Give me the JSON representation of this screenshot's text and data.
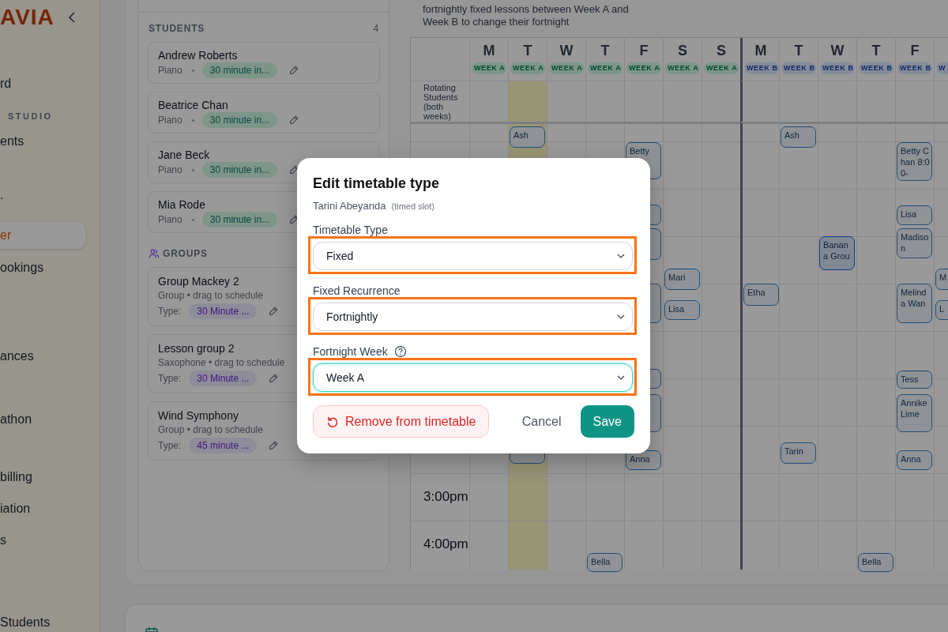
{
  "sidebar": {
    "logo": "AVIA",
    "items": [
      {
        "kind": "link",
        "label": "rd",
        "selected": false
      },
      {
        "kind": "section",
        "label": "STUDIO"
      },
      {
        "kind": "link",
        "label": "ents",
        "selected": false
      },
      {
        "kind": "link",
        "label": ".",
        "selected": false
      },
      {
        "kind": "link",
        "label": "er",
        "selected": true
      },
      {
        "kind": "link",
        "label": "ookings",
        "selected": false
      },
      {
        "kind": "link",
        "label": "ances",
        "selected": false
      },
      {
        "kind": "link",
        "label": "athon",
        "selected": false
      },
      {
        "kind": "link",
        "label": "billing",
        "selected": false
      },
      {
        "kind": "link",
        "label": "iation",
        "selected": false
      },
      {
        "kind": "link",
        "label": "s",
        "selected": false
      },
      {
        "kind": "link",
        "label": "Students",
        "selected": false
      }
    ]
  },
  "students": {
    "title": "STUDENTS",
    "count": "4",
    "items": [
      {
        "name": "Andrew Roberts",
        "instrument": "Piano",
        "lesson_type": "30 minute in..."
      },
      {
        "name": "Beatrice Chan",
        "instrument": "Piano",
        "lesson_type": "30 minute in..."
      },
      {
        "name": "Jane Beck",
        "instrument": "Piano",
        "lesson_type": "30 minute in..."
      },
      {
        "name": "Mia Rode",
        "instrument": "Piano",
        "lesson_type": "30 minute in..."
      }
    ]
  },
  "groups": {
    "title": "GROUPS",
    "items": [
      {
        "name": "Group Mackey 2",
        "detail": "Group • drag to schedule",
        "type_label": "Type:",
        "lesson_type": "30 Minute ..."
      },
      {
        "name": "Lesson group 2",
        "detail": "Saxophone • drag to schedule",
        "type_label": "Type:",
        "lesson_type": "30 Minute ..."
      },
      {
        "name": "Wind Symphony",
        "detail": "Group • drag to schedule",
        "type_label": "Type:",
        "lesson_type": "45 minute ..."
      }
    ]
  },
  "calendar": {
    "note": "fortnightly fixed lessons between Week A and Week B to change their fortnight",
    "rotating_label": "Rotating Students (both weeks)",
    "times": [
      "3:00pm",
      "4:00pm"
    ],
    "days": [
      {
        "letter": "M",
        "week": "WEEK A",
        "kind": "a",
        "today": false
      },
      {
        "letter": "T",
        "week": "WEEK A",
        "kind": "a",
        "today": true,
        "events": [
          {
            "kind": "lesson",
            "name": "Ash"
          },
          {
            "kind": "lesson"
          }
        ]
      },
      {
        "letter": "W",
        "week": "WEEK A",
        "kind": "a",
        "today": false
      },
      {
        "letter": "T",
        "week": "WEEK A",
        "kind": "a",
        "today": false,
        "events": [
          {
            "kind": "lesson",
            "name": "Bella"
          }
        ]
      },
      {
        "letter": "F",
        "week": "WEEK A",
        "kind": "a",
        "today": false,
        "events": [
          {
            "kind": "lesson",
            "name": "Betty"
          },
          {
            "kind": "lesson"
          },
          {
            "kind": "lesson"
          },
          {
            "kind": "lesson"
          },
          {
            "kind": "lesson"
          },
          {
            "kind": "lesson"
          },
          {
            "kind": "lesson",
            "name": "Anna"
          }
        ]
      },
      {
        "letter": "S",
        "week": "WEEK A",
        "kind": "a",
        "today": false,
        "events": [
          {
            "kind": "lesson",
            "name": "Mari"
          },
          {
            "kind": "lesson",
            "name": "Lisa"
          }
        ]
      },
      {
        "letter": "S",
        "week": "WEEK A",
        "kind": "a",
        "today": false
      },
      {
        "letter": "M",
        "week": "WEEK B",
        "kind": "b",
        "today": false,
        "events": [
          {
            "kind": "lesson",
            "name": "Etha"
          }
        ]
      },
      {
        "letter": "T",
        "week": "WEEK B",
        "kind": "b",
        "today": false,
        "events": [
          {
            "kind": "lesson",
            "name": "Ash"
          },
          {
            "kind": "lesson",
            "name": "Tarin"
          }
        ]
      },
      {
        "letter": "W",
        "week": "WEEK B",
        "kind": "b",
        "today": false,
        "events": [
          {
            "kind": "group",
            "name": "Banana Grou"
          }
        ]
      },
      {
        "letter": "T",
        "week": "WEEK B",
        "kind": "b",
        "today": false,
        "events": [
          {
            "kind": "lesson",
            "name": "Bella"
          }
        ]
      },
      {
        "letter": "F",
        "week": "WEEK B",
        "kind": "b",
        "today": false,
        "events": [
          {
            "kind": "lesson",
            "name": "Betty Chan 8:00-"
          },
          {
            "kind": "lesson",
            "name": "Lisa"
          },
          {
            "kind": "lesson",
            "name": "Madison"
          },
          {
            "kind": "lesson",
            "name": "Melinda Wan"
          },
          {
            "kind": "lesson",
            "name": "Tess"
          },
          {
            "kind": "lesson",
            "name": "Annike Lime"
          },
          {
            "kind": "lesson",
            "name": "Anna"
          }
        ]
      },
      {
        "week": "W",
        "kind": "b",
        "today": false,
        "events": [
          {
            "kind": "lesson",
            "name": "M"
          },
          {
            "kind": "lesson",
            "name": "L"
          }
        ]
      }
    ]
  },
  "dialog": {
    "title": "Edit timetable type",
    "student": "Tarini Abeyanda",
    "slot_note": "(timed slot)",
    "fields": [
      {
        "label": "Timetable Type",
        "value": "Fixed",
        "highlighted": true,
        "focused": false
      },
      {
        "label": "Fixed Recurrence",
        "value": "Fortnightly",
        "highlighted": true,
        "focused": false
      },
      {
        "label": "Fortnight Week",
        "value": "Week A",
        "highlighted": true,
        "focused": true,
        "help": true
      }
    ],
    "buttons": [
      {
        "kind": "danger",
        "label": "Remove from timetable"
      },
      {
        "kind": "text",
        "label": "Cancel"
      },
      {
        "kind": "primary",
        "label": "Save"
      }
    ]
  }
}
